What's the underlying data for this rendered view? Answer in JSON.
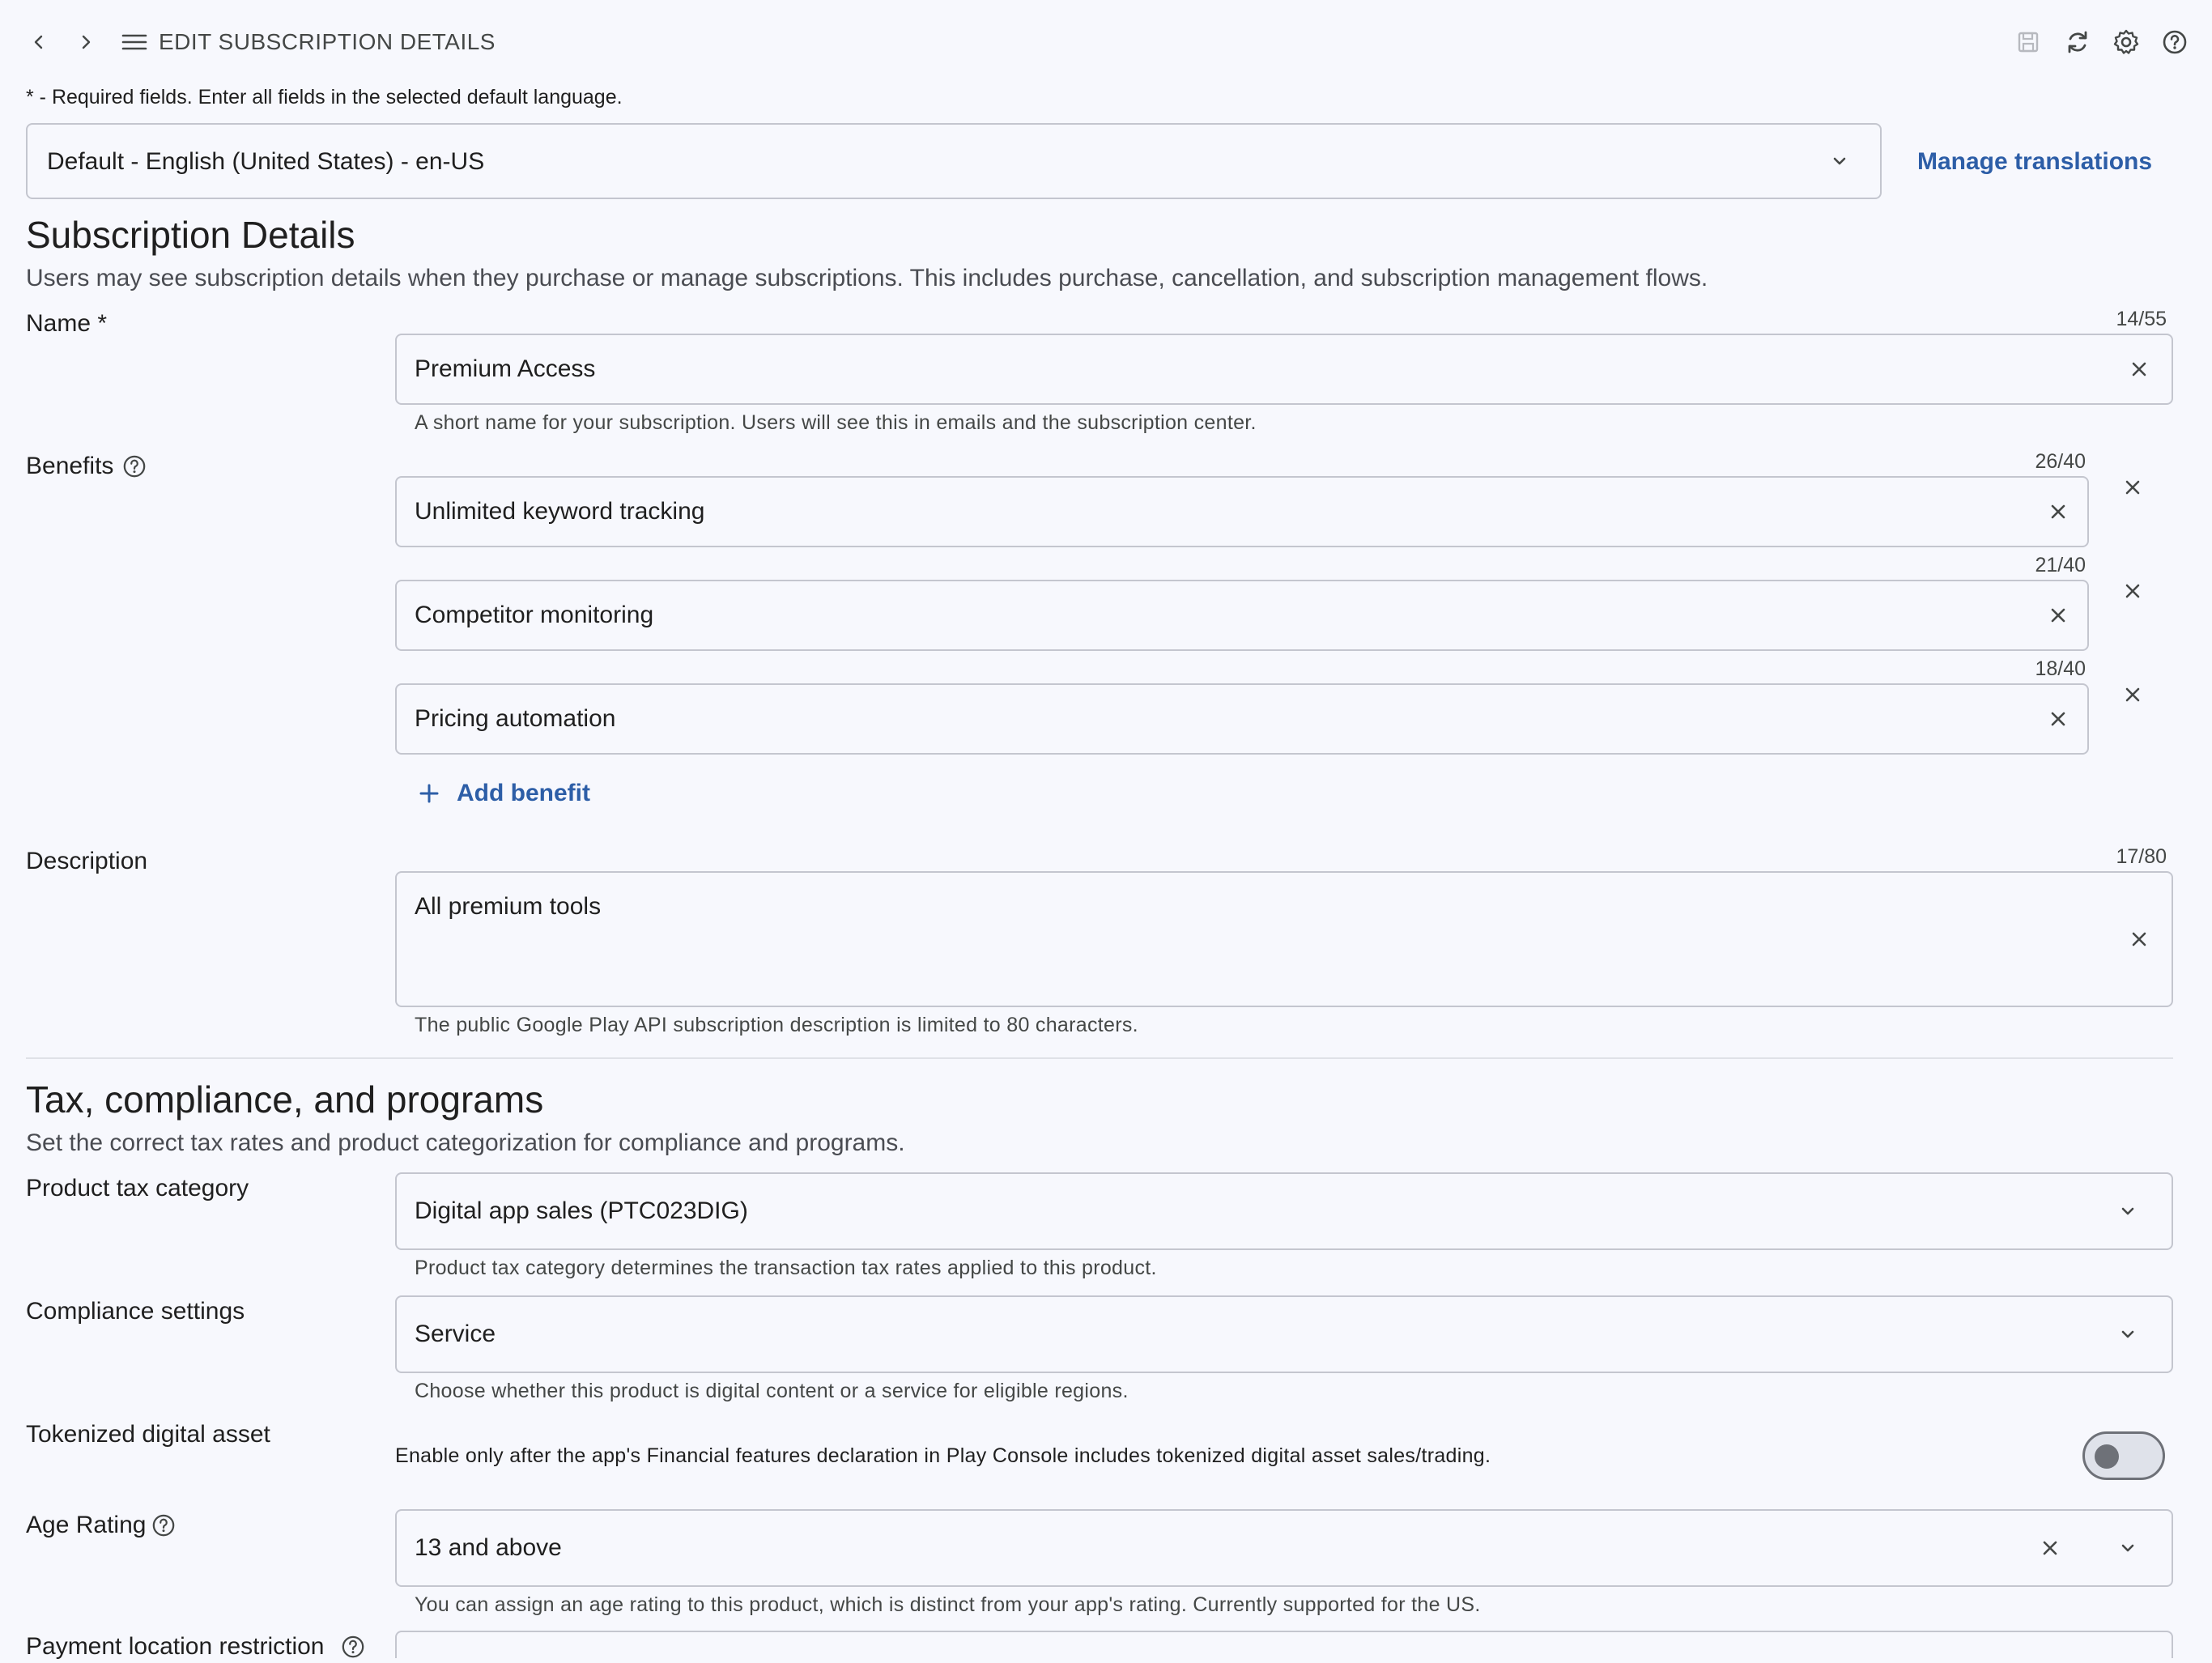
{
  "topbar": {
    "title": "EDIT SUBSCRIPTION DETAILS",
    "icons": [
      "back-arrow-icon",
      "forward-arrow-icon",
      "menu-icon",
      "save-icon",
      "refresh-icon",
      "settings-icon",
      "help-icon"
    ]
  },
  "required_note": "* - Required fields. Enter all fields in the selected default language.",
  "language": {
    "selected": "Default - English (United States) - en-US",
    "manage_link": "Manage translations"
  },
  "subscription_details": {
    "heading": "Subscription Details",
    "subtitle": "Users may see subscription details when they purchase or manage subscriptions. This includes purchase, cancellation, and subscription management flows.",
    "name": {
      "label": "Name *",
      "counter": "14/55",
      "value": "Premium Access",
      "hint": "A short name for your subscription. Users will see this in emails and the subscription center."
    },
    "benefits": {
      "label": "Benefits",
      "items": [
        {
          "counter": "26/40",
          "value": "Unlimited keyword tracking"
        },
        {
          "counter": "21/40",
          "value": "Competitor monitoring"
        },
        {
          "counter": "18/40",
          "value": "Pricing automation"
        }
      ],
      "add_label": "Add benefit"
    },
    "description": {
      "label": "Description",
      "counter": "17/80",
      "value": "All premium tools",
      "hint": "The public Google Play API subscription description is limited to 80 characters."
    }
  },
  "tax": {
    "heading": "Tax, compliance, and programs",
    "subtitle": "Set the correct tax rates and product categorization for compliance and programs.",
    "product_tax_category": {
      "label": "Product tax category",
      "value": "Digital app sales (PTC023DIG)",
      "hint": "Product tax category determines the transaction tax rates applied to this product."
    },
    "compliance": {
      "label": "Compliance settings",
      "value": "Service",
      "hint": "Choose whether this product is digital content or a service for eligible regions."
    },
    "tokenized": {
      "label": "Tokenized digital asset",
      "text": "Enable only after the app's Financial features declaration in Play Console includes tokenized digital asset sales/trading.",
      "enabled": false
    },
    "age_rating": {
      "label": "Age Rating",
      "value": "13 and above",
      "hint": "You can assign an age rating to this product, which is distinct from your app's rating. Currently supported for the US."
    },
    "payment_location": {
      "label": "Payment location restriction"
    }
  }
}
